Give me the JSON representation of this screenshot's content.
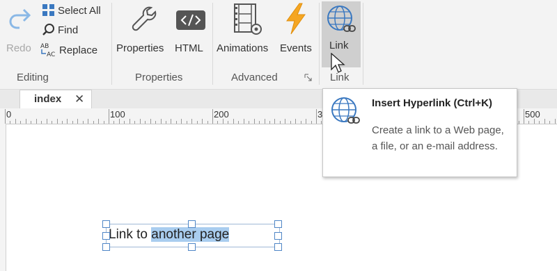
{
  "ribbon": {
    "groups": {
      "editing": "Editing",
      "properties": "Properties",
      "advanced": "Advanced",
      "link": "Link"
    },
    "buttons": {
      "redo": "Redo",
      "select_all": "Select All",
      "find": "Find",
      "replace": "Replace",
      "properties": "Properties",
      "html": "HTML",
      "animations": "Animations",
      "events": "Events",
      "link": "Link"
    },
    "dialog_launcher_icon": "dialog-launcher-icon"
  },
  "tabs": [
    {
      "label": "index",
      "close": "✕"
    }
  ],
  "ruler": {
    "labels": [
      "0",
      "100",
      "200",
      "3",
      "500"
    ]
  },
  "tooltip": {
    "title": "Insert Hyperlink (Ctrl+K)",
    "description": "Create a link to a Web page, a file, or an e-mail address."
  },
  "canvas": {
    "text_normal": "Link to ",
    "text_selected": "another page"
  },
  "colors": {
    "accent_blue": "#4a90d9",
    "events_orange": "#f5a623",
    "selection": "#a9cdef"
  }
}
